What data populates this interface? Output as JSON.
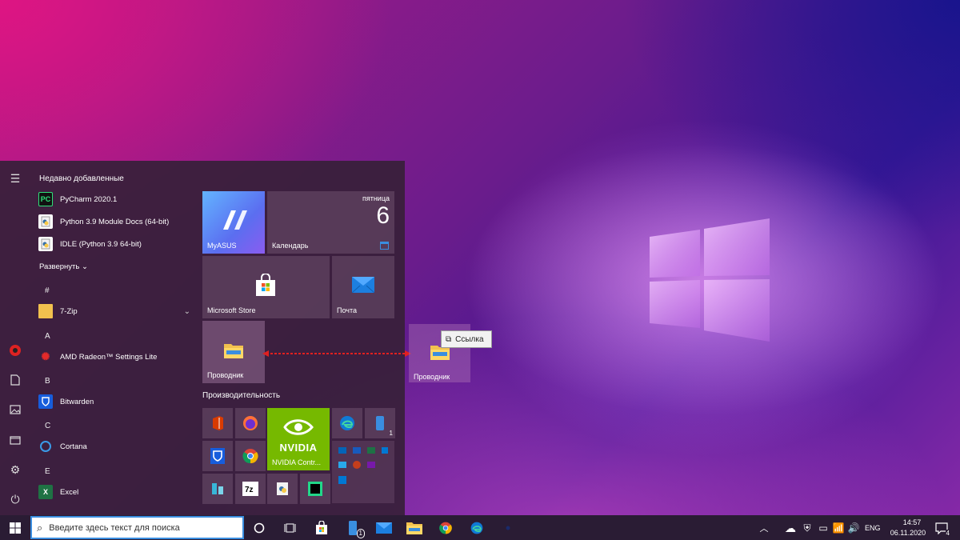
{
  "start_menu": {
    "recent_header": "Недавно добавленные",
    "recent_apps": [
      {
        "label": "PyCharm 2020.1",
        "icon": "pycharm-icon"
      },
      {
        "label": "Python 3.9 Module Docs (64-bit)",
        "icon": "python-docs-icon"
      },
      {
        "label": "IDLE (Python 3.9 64-bit)",
        "icon": "idle-icon"
      }
    ],
    "expand_label": "Развернуть",
    "groups": [
      {
        "letter": "#",
        "apps": [
          {
            "label": "7-Zip",
            "icon": "folder-icon"
          }
        ]
      },
      {
        "letter": "A",
        "apps": [
          {
            "label": "AMD Radeon™ Settings Lite",
            "icon": "amd-icon"
          }
        ]
      },
      {
        "letter": "B",
        "apps": [
          {
            "label": "Bitwarden",
            "icon": "bitwarden-icon"
          }
        ]
      },
      {
        "letter": "C",
        "apps": [
          {
            "label": "Cortana",
            "icon": "cortana-icon"
          }
        ]
      },
      {
        "letter": "E",
        "apps": [
          {
            "label": "Excel",
            "icon": "excel-icon"
          }
        ]
      }
    ],
    "tiles": {
      "myasus": "MyASUS",
      "calendar_label": "Календарь",
      "calendar_day": "пятница",
      "calendar_date": "6",
      "store": "Microsoft Store",
      "mail": "Почта",
      "explorer": "Проводник",
      "group_title": "Производительность",
      "nvidia": "NVIDIA Contr...",
      "phone_badge": "1"
    }
  },
  "drag": {
    "ghost_label": "Проводник",
    "tooltip": "Ссылка"
  },
  "taskbar": {
    "search_placeholder": "Введите здесь текст для поиска",
    "store_badge": "1",
    "language": "ENG",
    "time": "14:57",
    "date": "06.11.2020",
    "notification_count": "4"
  },
  "colors": {
    "accent": "#3a8ee0",
    "nvidia_green": "#76b900",
    "myasus_blue": "#5a8df0",
    "drag_arrow": "#e02020"
  }
}
